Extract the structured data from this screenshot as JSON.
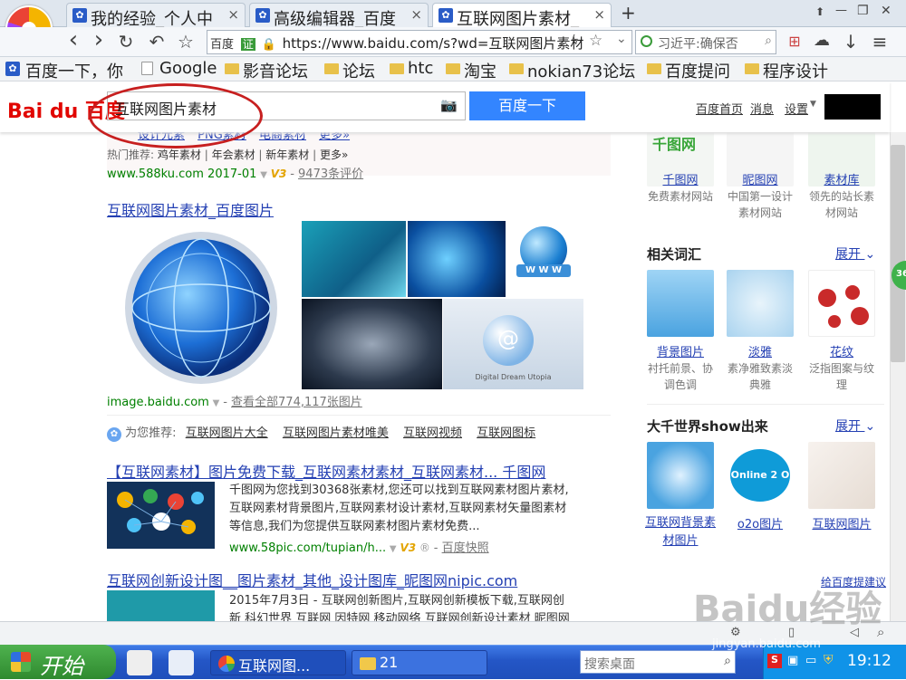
{
  "tabs": [
    {
      "label": "我的经验_个人中",
      "close": "×"
    },
    {
      "label": "高级编辑器_百度",
      "close": "×"
    },
    {
      "label": "互联网图片素材_",
      "close": "×"
    }
  ],
  "new_tab": "+",
  "window_controls": {
    "pin": "⬆",
    "min": "—",
    "max": "❐",
    "close": "✕"
  },
  "nav": {
    "back": "‹",
    "forward": "›",
    "reload": "↻",
    "undo": "↶",
    "star": "☆",
    "site_badge": "百度",
    "verified": "证",
    "url": "https://www.baidu.com/s?wd=互联网图片素材",
    "search_placeholder": "习近平:确保否",
    "right_icons": [
      "⊞",
      "☁",
      "↓",
      "≡"
    ]
  },
  "bookmarks": [
    "百度一下，你",
    "Google",
    "影音论坛",
    "论坛",
    "htc",
    "淘宝",
    "nokian73论坛",
    "百度提问",
    "程序设计"
  ],
  "header": {
    "logo": "Bai du 百度",
    "query": "互联网图片素材",
    "search_button": "百度一下",
    "links": [
      "百度首页",
      "消息",
      "设置"
    ]
  },
  "top_result": {
    "tags_row1": [
      "设计元素",
      "PNG素材",
      "电商素材",
      "更多»"
    ],
    "tags_row2_label": "热门推荐:",
    "tags_row2": [
      "鸡年素材",
      "年会素材",
      "新年素材",
      "更多»"
    ],
    "meta": "www.588ku.com  2017-01",
    "v3": "V3",
    "reviews": "9473条评价"
  },
  "image_result": {
    "title": "互联网图片素材_百度图片",
    "domain": "image.baidu.com",
    "more": "查看全部774,117张图片",
    "caption": "Digital Dream Utopia"
  },
  "recommend": {
    "label": "为您推荐:",
    "links": [
      "互联网图片大全",
      "互联网图片素材唯美",
      "互联网视频",
      "互联网图标"
    ]
  },
  "result2": {
    "title": "【互联网素材】图片免费下载_互联网素材素材_互联网素材... 千图网",
    "desc": "千图网为您找到30368张素材,您还可以找到互联网素材图片素材,互联网素材背景图片,互联网素材设计素材,互联网素材矢量图素材等信息,我们为您提供互联网素材图片素材免费...",
    "url": "www.58pic.com/tupian/h...",
    "snapshot": "百度快照"
  },
  "result3": {
    "title": "互联网创新设计图__图片素材_其他_设计图库_昵图网nipic.com",
    "desc": "2015年7月3日 - 互联网创新图片,互联网创新模板下载,互联网创新 科幻世界 互联网 因特网 移动网络 互联网创新设计素材 昵图网 图片共"
  },
  "right": {
    "sites": [
      {
        "name": "千图网",
        "desc": "免费素材网站"
      },
      {
        "name": "昵图网",
        "desc": "中国第一设计素材网站"
      },
      {
        "name": "素材库",
        "desc": "领先的站长素材网站"
      }
    ],
    "related_title": "相关词汇",
    "expand": "展开",
    "related": [
      {
        "name": "背景图片",
        "desc": "衬托前景、协调色调"
      },
      {
        "name": "淡雅",
        "desc": "素净雅致素淡典雅"
      },
      {
        "name": "花纹",
        "desc": "泛指图案与纹理"
      }
    ],
    "show_title": "大千世界show出来",
    "show": [
      {
        "name": "互联网背景素材图片"
      },
      {
        "name": "o2o图片",
        "img_text": "Online 2 O"
      },
      {
        "name": "互联网图片"
      }
    ],
    "feedback": "给百度提建议",
    "badge": "36"
  },
  "watermark": {
    "brand": "Baidu经验",
    "url": "jingyan.baidu.com"
  },
  "taskbar": {
    "start": "开始",
    "window1": "互联网图...",
    "window2": "21",
    "search_placeholder": "搜索桌面",
    "time": "19:12"
  },
  "colors": {
    "baidu_blue": "#3385ff",
    "link": "#2440b3",
    "green_url": "#008000",
    "annotation_red": "#c71f1f"
  }
}
